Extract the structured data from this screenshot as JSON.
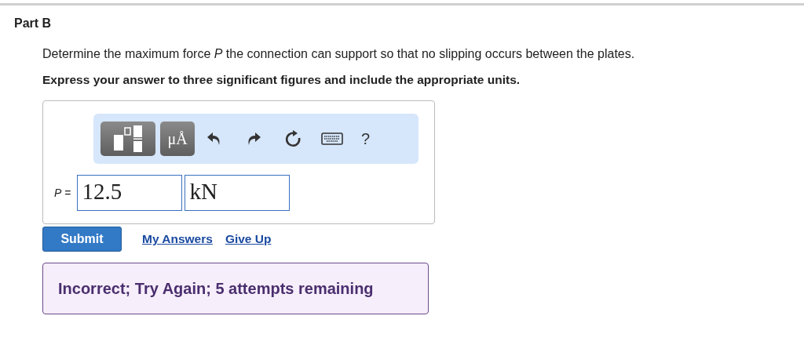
{
  "part_title": "Part B",
  "question": "Determine the maximum force *P* the connection can support so that no slipping occurs between the plates.",
  "instruction": "Express your answer to three significant figures and include the appropriate units.",
  "toolbar": {
    "units_button": "μÅ",
    "help_button": "?"
  },
  "answer": {
    "label": "*P* =",
    "value": "12.5",
    "units": "kN"
  },
  "submit": "Submit",
  "links": [
    "My Answers",
    "Give Up"
  ],
  "feedback": "Incorrect; Try Again; 5 attempts remaining"
}
